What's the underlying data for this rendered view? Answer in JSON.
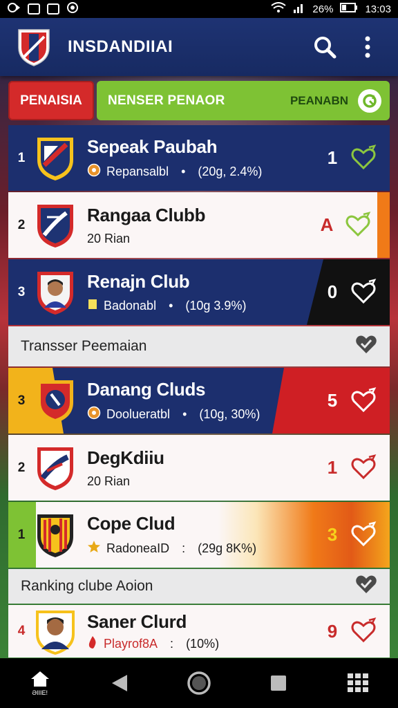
{
  "status_bar": {
    "battery": "26%",
    "time": "13:03"
  },
  "app_bar": {
    "title": "INSDANDIIAI",
    "icons": [
      "search-icon",
      "more-vert-icon"
    ]
  },
  "tabs": {
    "red_label": "PENAISIA",
    "green_label": "NENSER PENAOR",
    "green_sub": "PEANABN",
    "green_icon": "refresh-icon"
  },
  "rows": [
    {
      "rank": "1",
      "name": "Sepeak Paubah",
      "meta_label": "Repansalbl",
      "meta_value": "(20g, 2.4%)",
      "score": "1",
      "theme": "dark",
      "stripe": "none"
    },
    {
      "rank": "2",
      "name": "Rangaa Clubb",
      "meta_label": "20 Rian",
      "meta_value": "",
      "score": "A",
      "theme": "light",
      "stripe": "orange"
    },
    {
      "rank": "3",
      "name": "Renajn Club",
      "meta_label": "Badonabl",
      "meta_value": "(10g 3.9%)",
      "score": "0",
      "theme": "dark",
      "stripe": "black"
    }
  ],
  "section1": {
    "label": "Transser Peemaian"
  },
  "rows2": [
    {
      "rank": "3",
      "name": "Danang Cluds",
      "meta_label": "Doolueratbl",
      "meta_value": "(10g, 30%)",
      "score": "5",
      "theme": "dark",
      "stripe": "red"
    },
    {
      "rank": "2",
      "name": "DegKdiiu",
      "meta_label": "20 Rian",
      "meta_value": "",
      "score": "1",
      "theme": "light",
      "stripe": "none"
    },
    {
      "rank": "1",
      "name": "Cope Clud",
      "meta_label": "RadoneaID",
      "meta_value": "(29g 8K%)",
      "score": "3",
      "theme": "light",
      "stripe": "orange-grad"
    }
  ],
  "section2": {
    "label": "Ranking clube Aoion"
  },
  "rows3": [
    {
      "rank": "4",
      "name": "Saner Clurd",
      "meta_label": "Playrof8A",
      "meta_value": "(10%)",
      "score": "9",
      "theme": "light",
      "stripe": "none"
    }
  ],
  "navbar": {
    "home_label": "ƏIIIE!",
    "icons": [
      "home-icon",
      "back-icon",
      "home-circle-icon",
      "recents-icon",
      "apps-grid-icon"
    ]
  },
  "colors": {
    "navy": "#1c2f6e",
    "red": "#d42a2a",
    "green": "#7ec234",
    "orange": "#f07a18",
    "heart_green": "#8cc63f",
    "heart_red": "#c82b2b"
  }
}
